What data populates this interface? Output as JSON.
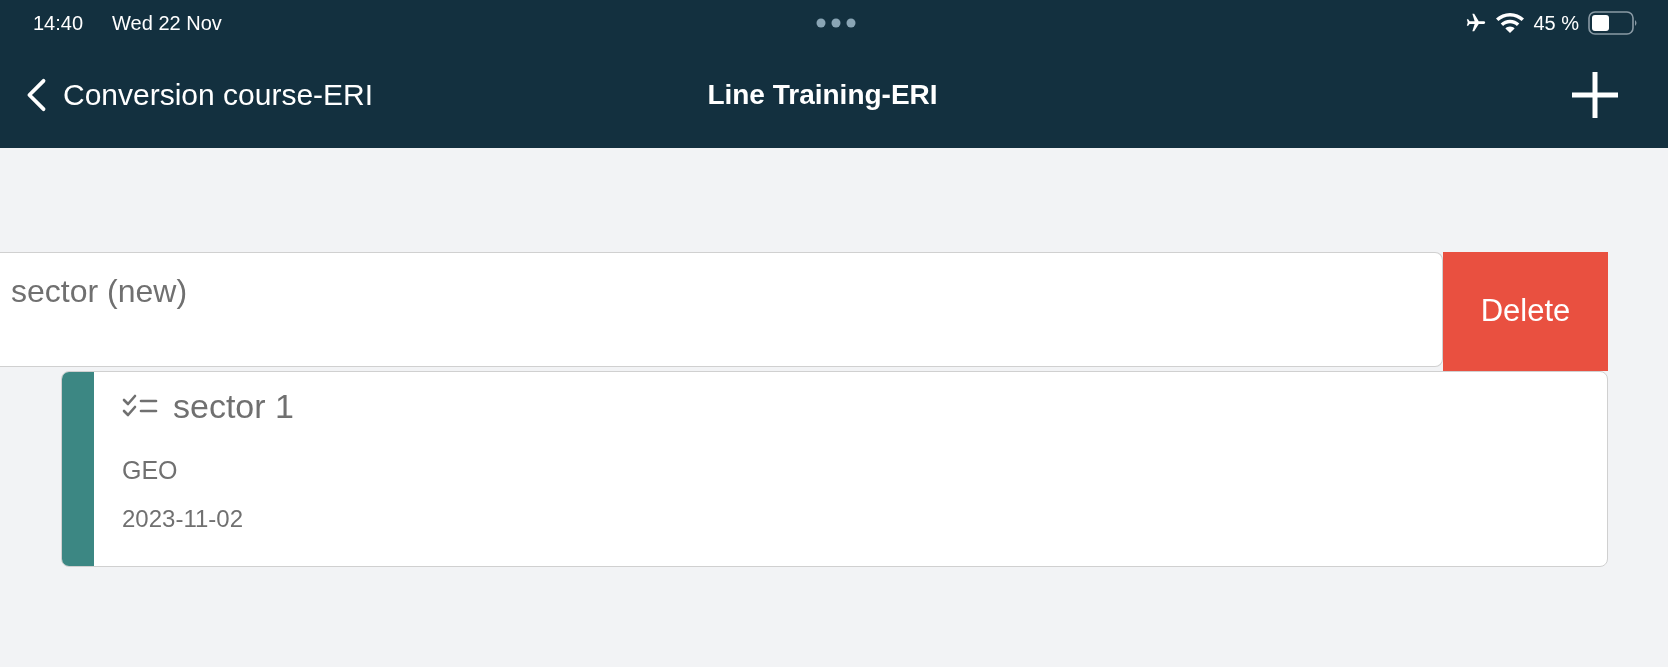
{
  "status_bar": {
    "time": "14:40",
    "date": "Wed 22 Nov",
    "battery": "45 %"
  },
  "nav_bar": {
    "back_label": "Conversion course-ERI",
    "title": "Line Training-ERI"
  },
  "swiped_row": {
    "title": "sector (new)",
    "action": "Delete"
  },
  "cards": [
    {
      "title": "sector 1",
      "subtitle": "GEO",
      "date": "2023-11-02",
      "color": "#3c8783"
    }
  ]
}
